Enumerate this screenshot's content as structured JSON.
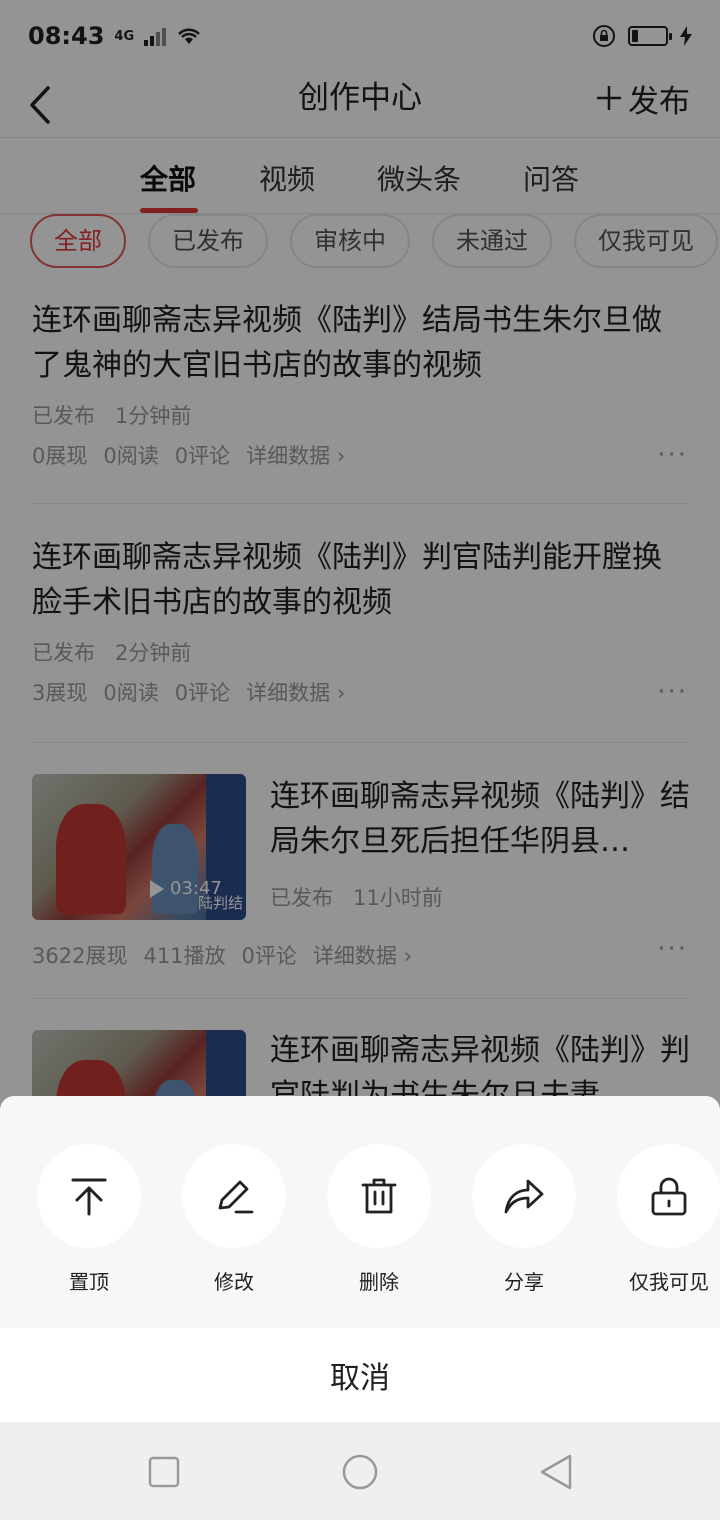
{
  "status_bar": {
    "time": "08:43",
    "network": "4G",
    "battery_level": 0.2
  },
  "nav": {
    "back_icon": "chevron-left-icon",
    "title": "创作中心",
    "publish_label": "发布"
  },
  "tabs": [
    {
      "label": "全部",
      "active": true
    },
    {
      "label": "视频",
      "active": false
    },
    {
      "label": "微头条",
      "active": false
    },
    {
      "label": "问答",
      "active": false
    }
  ],
  "filters": [
    {
      "label": "全部",
      "active": true
    },
    {
      "label": "已发布",
      "active": false
    },
    {
      "label": "审核中",
      "active": false
    },
    {
      "label": "未通过",
      "active": false
    },
    {
      "label": "仅我可见",
      "active": false
    }
  ],
  "posts": [
    {
      "title": "连环画聊斋志异视频《陆判》结局书生朱尔旦做了鬼神的大官旧书店的故事的视频",
      "status": "已发布",
      "time": "1分钟前",
      "stats": [
        "0展现",
        "0阅读",
        "0评论"
      ],
      "detail_label": "详细数据"
    },
    {
      "title": "连环画聊斋志异视频《陆判》判官陆判能开膛换脸手术旧书店的故事的视频",
      "status": "已发布",
      "time": "2分钟前",
      "stats": [
        "3展现",
        "0阅读",
        "0评论"
      ],
      "detail_label": "详细数据"
    },
    {
      "title": "连环画聊斋志异视频《陆判》结局朱尔旦死后担任华阴县…",
      "status": "已发布",
      "time": "11小时前",
      "duration": "03:47",
      "thumb_caption": "陆判结",
      "stats": [
        "3622展现",
        "411播放",
        "0评论"
      ],
      "detail_label": "详细数据"
    },
    {
      "title": "连环画聊斋志异视频《陆判》判官陆判为书生朱尔旦夫妻"
    }
  ],
  "sheet": {
    "actions": [
      {
        "label": "置顶",
        "icon": "pin-top-icon"
      },
      {
        "label": "修改",
        "icon": "pencil-icon"
      },
      {
        "label": "删除",
        "icon": "trash-icon"
      },
      {
        "label": "分享",
        "icon": "share-arrow-icon"
      },
      {
        "label": "仅我可见",
        "icon": "lock-icon"
      }
    ],
    "cancel_label": "取消"
  }
}
